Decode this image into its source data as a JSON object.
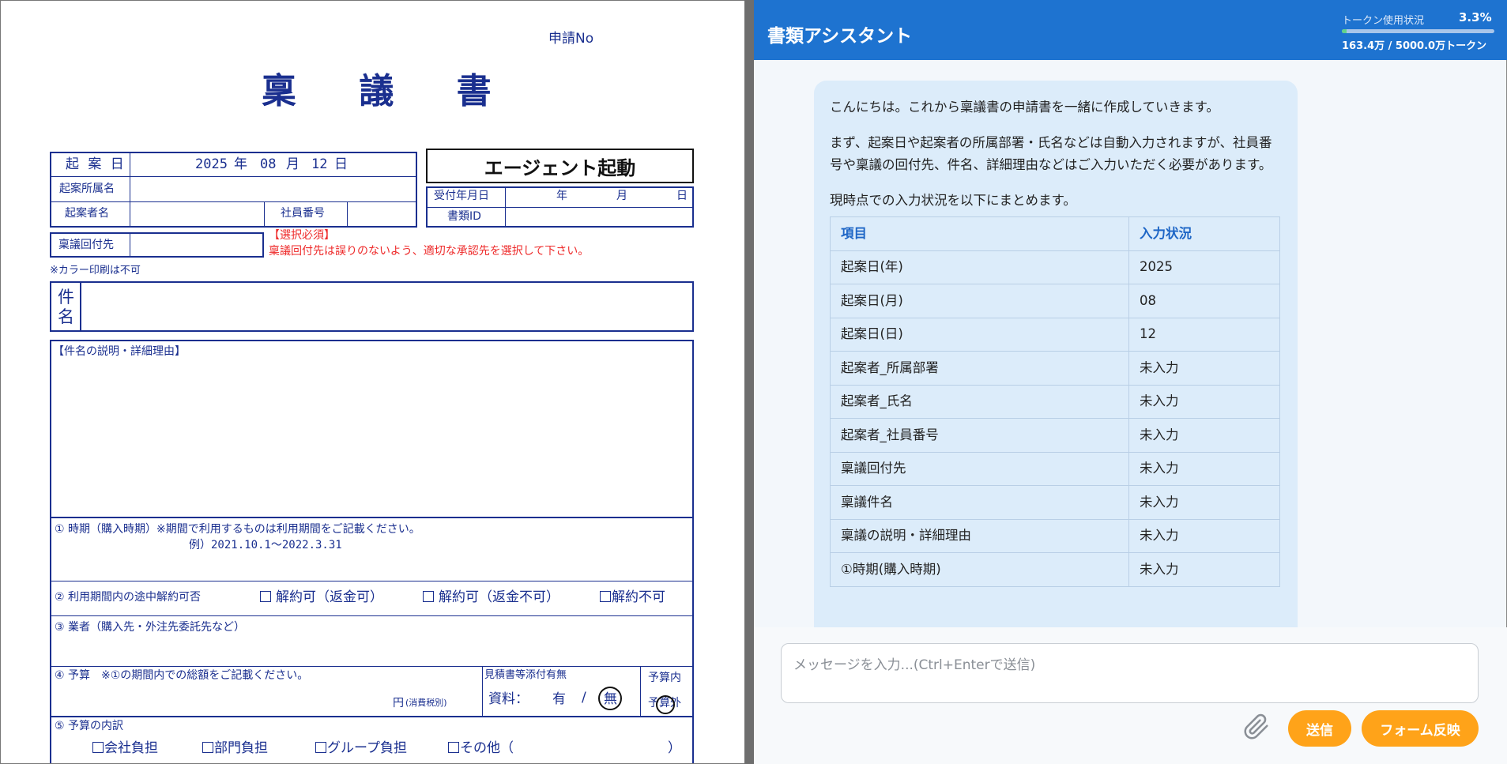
{
  "document": {
    "application_no_label": "申請No",
    "title": "稟 議 書",
    "agent_button_label": "エージェント起動",
    "date_label": "起 案 日",
    "date_year": "2025",
    "year_unit": "年",
    "date_month": "08",
    "month_unit": "月",
    "date_day": "12",
    "day_unit": "日",
    "department_label": "起案所属名",
    "author_label": "起案者名",
    "employee_no_label": "社員番号",
    "received_date_label": "受付年月日",
    "received_year_unit": "年",
    "received_month_unit": "月",
    "received_day_unit": "日",
    "document_id_label": "書類ID",
    "routing_label": "稟議回付先",
    "required_note": "【選択必須】",
    "routing_note": "稟議回付先は誤りのないよう、適切な承認先を選択して下さい。",
    "color_print_note": "※カラー印刷は不可",
    "subject_label_1": "件",
    "subject_label_2": "名",
    "detail_label": "【件名の説明・詳細理由】",
    "period_label": "① 時期（購入時期）※期間で利用するものは利用期間をご記載ください。",
    "period_example": "例）2021.10.1～2022.3.31",
    "cancel_label": "② 利用期間内の途中解約可否",
    "cancel_opt1": "解約可（返金可）",
    "cancel_opt2": "解約可（返金不可）",
    "cancel_opt3": "解約不可",
    "vendor_label": "③ 業者（購入先・外注先委託先など）",
    "budget_label": "④ 予算　※①の期間内での総額をご記載ください。",
    "budget_yen": "円",
    "budget_tax": "(消費税別)",
    "estimate_label": "見積書等添付有無",
    "material_label": "資料：",
    "material_yes": "有",
    "material_slash": "/",
    "material_no": "無",
    "budget_in": "予算内",
    "budget_out": "予算外",
    "breakdown_label": "⑤ 予算の内訳",
    "breakdown_opt1": "会社負担",
    "breakdown_opt2": "部門負担",
    "breakdown_opt3": "グループ負担",
    "breakdown_opt4": "その他（",
    "breakdown_close": "）"
  },
  "assistant": {
    "title": "書類アシスタント",
    "token_label": "トークン使用状況",
    "token_percent": "3.3%",
    "token_fraction": 0.033,
    "token_count": "163.4万 / 5000.0万トークン",
    "message_p1": "こんにちは。これから稟議書の申請書を一緒に作成していきます。",
    "message_p2": "まず、起案日や起案者の所属部署・氏名などは自動入力されますが、社員番号や稟議の回付先、件名、詳細理由などはご入力いただく必要があります。",
    "message_p3": "現時点での入力状況を以下にまとめます。",
    "table_header": {
      "item": "項目",
      "status": "入力状況"
    },
    "table_rows": [
      {
        "item": "起案日(年)",
        "status": "2025"
      },
      {
        "item": "起案日(月)",
        "status": "08"
      },
      {
        "item": "起案日(日)",
        "status": "12"
      },
      {
        "item": "起案者_所属部署",
        "status": "未入力"
      },
      {
        "item": "起案者_氏名",
        "status": "未入力"
      },
      {
        "item": "起案者_社員番号",
        "status": "未入力"
      },
      {
        "item": "稟議回付先",
        "status": "未入力"
      },
      {
        "item": "稟議件名",
        "status": "未入力"
      },
      {
        "item": "稟議の説明・詳細理由",
        "status": "未入力"
      },
      {
        "item": "①時期(購入時期)",
        "status": "未入力"
      }
    ],
    "input_placeholder": "メッセージを入力...(Ctrl+Enterで送信)",
    "send_label": "送信",
    "form_apply_label": "フォーム反映"
  },
  "colors": {
    "header": "#1e73d0",
    "accent_button": "#ffa319",
    "form_blue": "#1a2f8f",
    "bubble": "#dcecfa"
  }
}
